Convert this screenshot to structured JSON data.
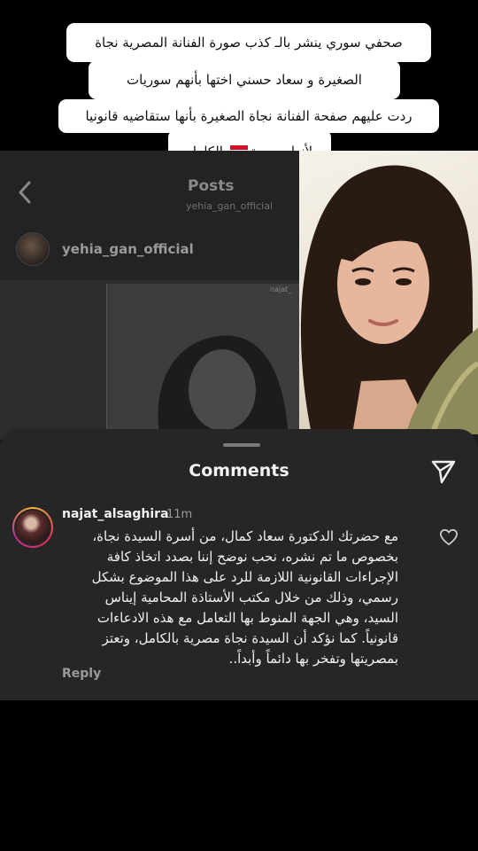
{
  "captions": {
    "line1": "صحفي سوري ينشر بالـ كذب  صورة  الفنانة المصرية نجاة",
    "line2": "الصغيرة و سعاد حسني اختها بأنهم سوريات",
    "line3": "ردت عليهم صفحة الفنانة نجاة الصغيرة بأنها ستقاضيه قانونيا",
    "line4_before": "لأنها مصرية",
    "line4_after": "بالكامل",
    "flag_colors": [
      "#ce1126",
      "#ffffff",
      "#000000"
    ]
  },
  "posts_screen": {
    "title": "Posts",
    "username": "yehia_gan_official",
    "post_username": "yehia_gan_official",
    "post_tag": "najat_"
  },
  "comments": {
    "title": "Comments",
    "items": [
      {
        "username": "najat_alsaghira",
        "time": "11m",
        "text": "مع حضرتك الدكتورة سعاد كمال، من أسرة السيدة نجاة،\nبخصوص ما تم نشره، نحب نوضح إننا بصدد اتخاذ كافة\nالإجراءات القانونية اللازمة للرد على هذا الموضوع بشكل\nرسمي، وذلك من خلال مكتب الأستاذة المحامية إيناس\nالسيد، وهي الجهة المنوط بها التعامل مع هذه الادعاءات\nقانونياً. كما نؤكد أن السيدة نجاة مصرية بالكامل، وتعتز\nبمصريتها وتفخر بها دائماً وأبداً..",
        "reply_label": "Reply"
      }
    ]
  },
  "icons": {
    "back": "chevron-left-icon",
    "send": "send-icon",
    "like": "heart-icon"
  },
  "colors": {
    "sheet_bg": "#262626",
    "text_primary": "#f2f2f2",
    "text_secondary": "#9a9a9a"
  }
}
